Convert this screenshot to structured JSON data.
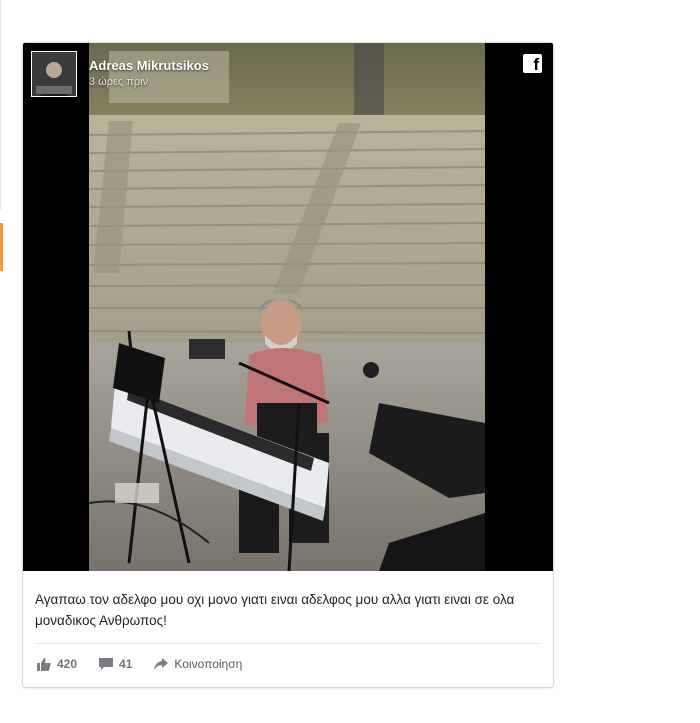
{
  "post": {
    "author": "Adreas Mikrutsikos",
    "time": "3 ώρες πριν",
    "caption": "Αγαπαω τον αδελφο μου οχι μονο γιατι ειναι αδελφος μου αλλα γιατι ειναι σε ολα μοναδικος Ανθρωπος!",
    "likes": "420",
    "comments": "41",
    "share_label": "Κοινοποίηση"
  },
  "icons": {
    "platform": "facebook-icon",
    "like": "thumbs-up-icon",
    "comment": "speech-bubble-icon",
    "share": "share-arrow-icon"
  },
  "colors": {
    "card_border": "#d8dbe0",
    "text": "#1d2129",
    "muted": "#6f7275",
    "accent": "#f39c34"
  }
}
